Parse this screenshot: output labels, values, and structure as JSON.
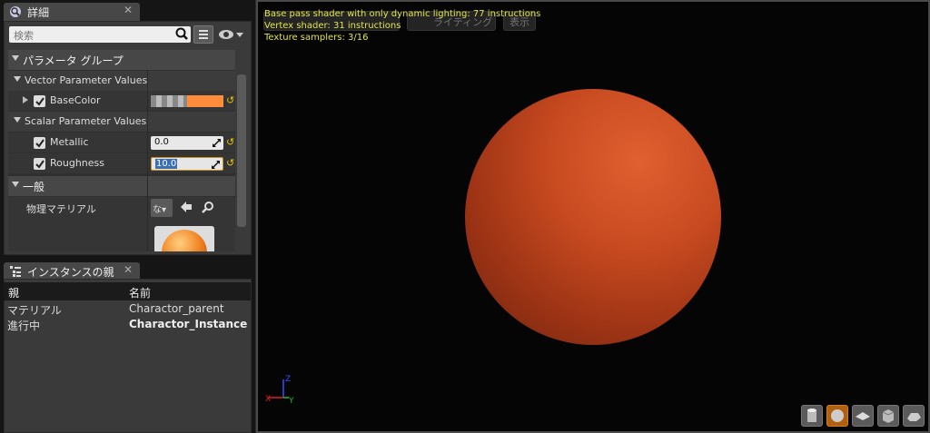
{
  "details_tab": {
    "title": "詳細",
    "close": "✕"
  },
  "search": {
    "placeholder": "検索"
  },
  "details": {
    "param_group": "パラメータ グループ",
    "vector_section": "Vector Parameter Values",
    "base_color_label": "BaseColor",
    "base_color": "#ff8c3a",
    "scalar_section": "Scalar Parameter Values",
    "metallic_label": "Metallic",
    "metallic_value": "0.0",
    "roughness_label": "Roughness",
    "roughness_value": "10.0",
    "general_section": "一般",
    "phys_material_label": "物理マテリアル",
    "phys_material_dropdown": "な",
    "reset_glyph": "↺"
  },
  "instance_tab": {
    "title": "インスタンスの親",
    "close": "✕"
  },
  "instance_table": {
    "headers": [
      "親",
      "名前"
    ],
    "rows": [
      {
        "parent": "マテリアル",
        "name": "Charactor_parent"
      },
      {
        "parent": "進行中",
        "name": "Charactor_Instance"
      }
    ]
  },
  "viewport": {
    "stats": [
      "Base pass shader with only dynamic lighting: 77 instructions",
      "Vertex shader: 31 instructions",
      "Texture samplers: 3/16"
    ],
    "lighting_button": "ライティング",
    "show_button": "表示",
    "axis_z": "Z",
    "axis_x": "X",
    "axis_y": "Y"
  },
  "colors": {
    "accent": "#e3e34a",
    "sphere": "#c8461e"
  }
}
